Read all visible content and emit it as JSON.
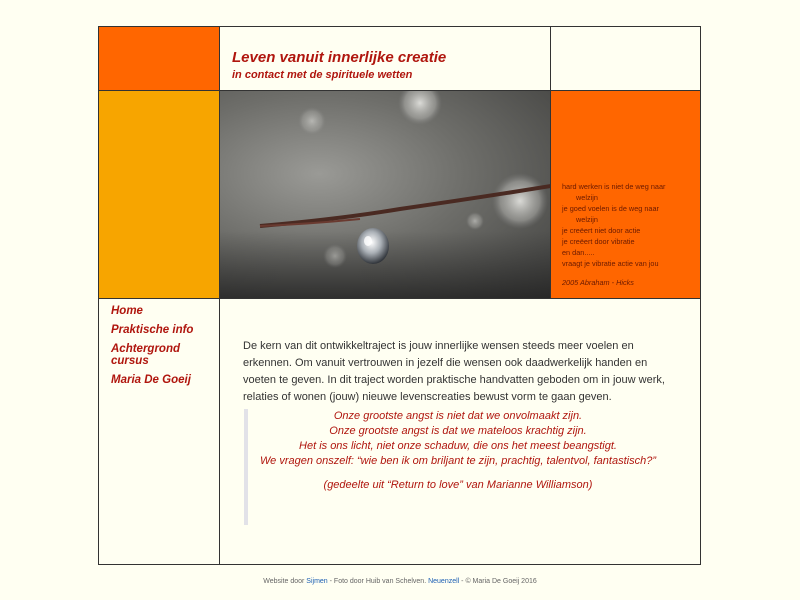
{
  "header": {
    "title": "Leven vanuit innerlijke creatie",
    "subtitle": "in contact met de spirituele wetten"
  },
  "side_quote": {
    "lines": [
      "hard werken is niet de weg naar",
      "welzijn",
      "je goed voelen is de weg naar",
      "welzijn",
      "je creëert niet door actie",
      "je creëert door vibratie",
      "en dan.....",
      "vraagt je vibratie actie van jou"
    ],
    "source": "2005 Abraham - Hicks"
  },
  "nav": {
    "items": [
      {
        "label": "Home"
      },
      {
        "label": "Praktische info"
      },
      {
        "label": "Achtergrond cursus"
      },
      {
        "label": "Maria De Goeij"
      }
    ]
  },
  "main": {
    "intro": "De kern van dit ontwikkeltraject is jouw innerlijke wensen steeds meer voelen en erkennen. Om vanuit vertrouwen in jezelf die wensen ook daadwerkelijk handen en voeten te geven. In dit traject worden praktische handvatten geboden om in jouw werk, relaties of wonen (jouw) nieuwe levenscreaties bewust vorm te gaan geven.",
    "quote_lines": [
      "Onze grootste angst is niet dat we onvolmaakt zijn.",
      "Onze grootste angst is dat we mateloos krachtig zijn.",
      "Het is ons licht, niet onze schaduw, die ons het meest beangstigt.",
      "We vragen onszelf: “wie ben ik om briljant te zijn, prachtig, talentvol, fantastisch?”"
    ],
    "quote_citation": "(gedeelte uit “Return to love” van Marianne Williamson)"
  },
  "footer": {
    "prefix": "Website door",
    "link1": "Sijmen",
    "middle": " - Foto door Huib van Schelven. ",
    "link2": "Neuenzell",
    "suffix": " - © Maria De Goeij 2016"
  },
  "colors": {
    "orange": "#ff6600",
    "amber": "#f7a500",
    "accent_red": "#b0160e",
    "background": "#fffff2"
  },
  "photo": {
    "icon": "water-droplet-photo"
  }
}
